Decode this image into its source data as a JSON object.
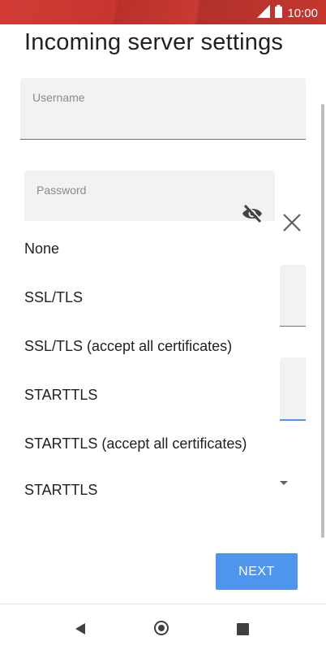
{
  "status_bar": {
    "time": "10:00"
  },
  "page": {
    "title": "Incoming server settings"
  },
  "fields": {
    "username": {
      "label": "Username",
      "value": ""
    },
    "password": {
      "label": "Password",
      "value": ""
    }
  },
  "security_menu": {
    "options": [
      "None",
      "SSL/TLS",
      "SSL/TLS (accept all certificates)",
      "STARTTLS",
      "STARTTLS (accept all certificates)"
    ],
    "selected_value": "STARTTLS"
  },
  "actions": {
    "next_label": "NEXT"
  },
  "colors": {
    "status_bar": "#c8362f",
    "accent": "#4f95ed"
  }
}
